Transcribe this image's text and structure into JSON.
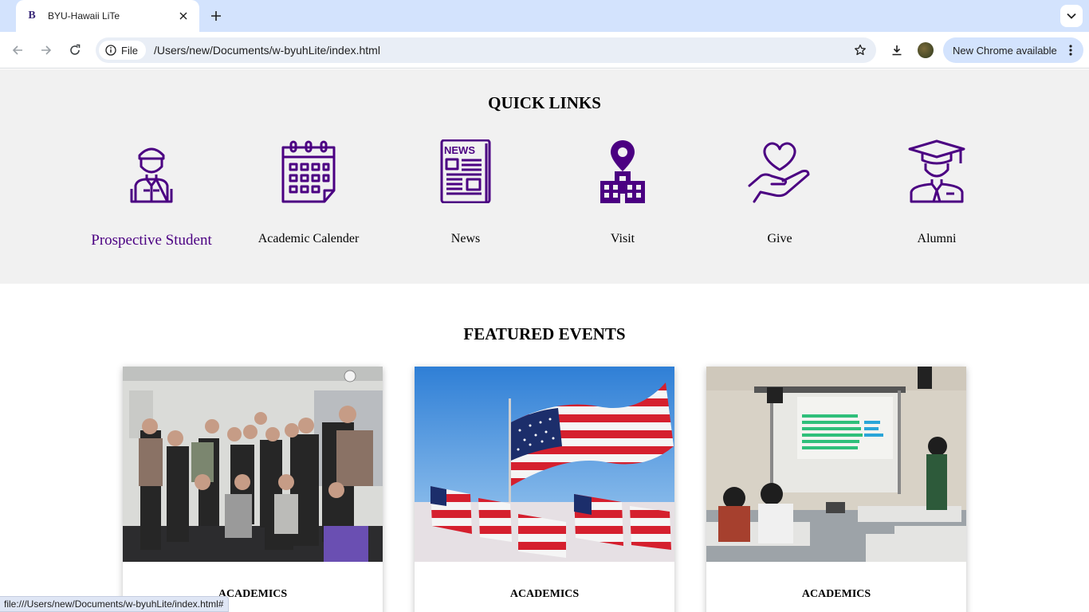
{
  "browser": {
    "tab_title": "BYU-Hawaii LiTe",
    "tab_favicon_letter": "B",
    "omnibox_chip": "File",
    "url": "/Users/new/Documents/w-byuhLite/index.html",
    "update_label": "New Chrome available",
    "status_url": "file:///Users/new/Documents/w-byuhLite/index.html#"
  },
  "quick_links": {
    "title": "QUICK LINKS",
    "items": [
      {
        "label": "Prospective Student",
        "icon": "student-icon"
      },
      {
        "label": "Academic Calender",
        "icon": "calendar-icon"
      },
      {
        "label": "News",
        "icon": "newspaper-icon"
      },
      {
        "label": "Visit",
        "icon": "location-building-icon"
      },
      {
        "label": "Give",
        "icon": "heart-hand-icon"
      },
      {
        "label": "Alumni",
        "icon": "graduate-icon"
      }
    ],
    "accent_color": "#4b0082"
  },
  "featured_events": {
    "title": "FEATURED EVENTS",
    "cards": [
      {
        "category": "ACADEMICS",
        "image": "group-photo"
      },
      {
        "category": "ACADEMICS",
        "image": "american-flags-photo"
      },
      {
        "category": "ACADEMICS",
        "image": "classroom-presentation-photo"
      }
    ]
  }
}
